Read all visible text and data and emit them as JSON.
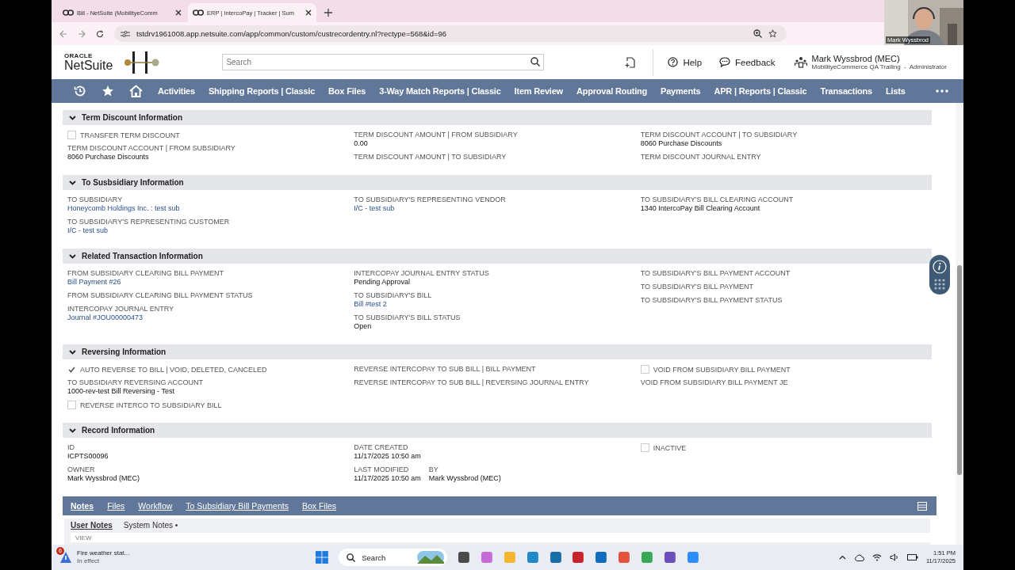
{
  "browser": {
    "tabs": [
      {
        "title": "Bill - NetSuite (MobilityeComm",
        "selected": false
      },
      {
        "title": "ERP | IntercoPay | Tracker | Sum",
        "selected": true
      }
    ],
    "url": "tstdrv1961008.app.netsuite.com/app/common/custom/custrecordentry.nl?rectype=568&id=96"
  },
  "webcam": {
    "name": "Mark Wyssbrod"
  },
  "header": {
    "logo_top": "ORACLE",
    "logo_bottom": "NetSuite",
    "search_placeholder": "Search",
    "help": "Help",
    "feedback": "Feedback",
    "user": "Mark Wyssbrod (MEC)",
    "account": "MobilityeCommerce QA Trailing  -  Administrator"
  },
  "nav": [
    "Activities",
    "Shipping Reports | Classic",
    "Box Files",
    "3-Way Match Reports | Classic",
    "Item Review",
    "Approval Routing",
    "Payments",
    "APR | Reports | Classic",
    "Transactions",
    "Lists"
  ],
  "sections": [
    {
      "title": "Term Discount Information",
      "expanded": true,
      "columns": [
        [
          {
            "kind": "checkbox",
            "label": "TRANSFER TERM DISCOUNT",
            "checked": false
          },
          {
            "kind": "field",
            "label": "TERM DISCOUNT ACCOUNT | FROM SUBSIDIARY",
            "value": "8060 Purchase Discounts",
            "link": false
          }
        ],
        [
          {
            "kind": "field",
            "label": "TERM DISCOUNT AMOUNT | FROM SUBSIDIARY",
            "value": "0.00",
            "link": false
          },
          {
            "kind": "field",
            "label": "TERM DISCOUNT AMOUNT | TO SUBSIDIARY"
          }
        ],
        [
          {
            "kind": "field",
            "label": "TERM DISCOUNT ACCOUNT | TO SUBSIDIARY",
            "value": "8060 Purchase Discounts",
            "link": false
          },
          {
            "kind": "field",
            "label": "TERM DISCOUNT JOURNAL ENTRY"
          }
        ]
      ]
    },
    {
      "title": "To Susbsidiary Information",
      "expanded": true,
      "columns": [
        [
          {
            "kind": "field",
            "label": "TO SUBSIDIARY",
            "value": "Honeycomb Holdings Inc. : test sub",
            "link": true
          },
          {
            "kind": "field",
            "label": "TO SUBSIDIARY'S REPRESENTING CUSTOMER",
            "value": "I/C - test sub",
            "link": true
          }
        ],
        [
          {
            "kind": "field",
            "label": "TO SUBSIDIARY'S REPRESENTING VENDOR",
            "value": "I/C - test sub",
            "link": true
          }
        ],
        [
          {
            "kind": "field",
            "label": "TO SUBSIDIARY'S BILL CLEARING ACCOUNT",
            "value": "1340 IntercoPay Bill Clearing Account",
            "link": false
          }
        ]
      ]
    },
    {
      "title": "Related Transaction Information",
      "expanded": true,
      "columns": [
        [
          {
            "kind": "field",
            "label": "FROM SUBSIDIARY CLEARING BILL PAYMENT",
            "value": "Bill Payment #26",
            "link": true
          },
          {
            "kind": "field",
            "label": "FROM SUBSIDIARY CLEARING BILL PAYMENT STATUS"
          },
          {
            "kind": "field",
            "label": "INTERCOPAY JOURNAL ENTRY",
            "value": "Journal #JOU00000473",
            "link": true
          }
        ],
        [
          {
            "kind": "field",
            "label": "INTERCOPAY JOURNAL ENTRY STATUS",
            "value": "Pending Approval",
            "link": false
          },
          {
            "kind": "field",
            "label": "TO SUBSIDIARY'S BILL",
            "value": "Bill #test 2",
            "link": true
          },
          {
            "kind": "field",
            "label": "TO SUBSIDIARY'S BILL STATUS",
            "value": "Open",
            "link": false
          }
        ],
        [
          {
            "kind": "field",
            "label": "TO SUBSIDIARY'S BILL PAYMENT ACCOUNT"
          },
          {
            "kind": "field",
            "label": "TO SUBSIDIARY'S BILL PAYMENT"
          },
          {
            "kind": "field",
            "label": "TO SUBSIDIARY'S BILL PAYMENT STATUS"
          }
        ]
      ]
    },
    {
      "title": "Reversing Information",
      "expanded": true,
      "columns": [
        [
          {
            "kind": "checkbox",
            "label": "AUTO REVERSE TO BILL | VOID, DELETED, CANCELED",
            "checked": true
          },
          {
            "kind": "field",
            "label": "TO SUBSIDIARY REVERSING ACCOUNT",
            "value": "1000-rev-test Bill Reversing - Test",
            "link": false
          },
          {
            "kind": "checkbox",
            "label": "REVERSE INTERCO TO SUBSIDIARY BILL",
            "checked": false
          }
        ],
        [
          {
            "kind": "field",
            "label": "REVERSE INTERCOPAY TO SUB BILL | BILL PAYMENT"
          },
          {
            "kind": "field",
            "label": "REVERSE INTERCOPAY TO SUB BILL | REVERSING JOURNAL ENTRY"
          }
        ],
        [
          {
            "kind": "checkbox",
            "label": "VOID FROM SUBSIDIARY BILL PAYMENT",
            "checked": false
          },
          {
            "kind": "field",
            "label": "VOID FROM SUBSIDIARY BILL PAYMENT JE"
          }
        ]
      ]
    },
    {
      "title": "Record Information",
      "expanded": true,
      "columns": [
        [
          {
            "kind": "field",
            "label": "ID",
            "value": "ICPTS00096",
            "link": false
          },
          {
            "kind": "field",
            "label": "OWNER",
            "value": "Mark Wyssbrod (MEC)",
            "link": false
          }
        ],
        [
          {
            "kind": "field",
            "label": "DATE CREATED",
            "value": "11/17/2025 10:50 am",
            "link": false
          },
          {
            "kind": "pair",
            "items": [
              {
                "label": "LAST MODIFIED",
                "value": "11/17/2025 10:50 am"
              },
              {
                "label": "BY",
                "value": "Mark Wyssbrod (MEC)"
              }
            ]
          }
        ],
        [
          {
            "kind": "checkbox",
            "label": "INACTIVE",
            "checked": false
          }
        ]
      ]
    }
  ],
  "subtabs": [
    {
      "label": "Notes",
      "selected": true
    },
    {
      "label": "Files",
      "selected": false
    },
    {
      "label": "Workflow",
      "selected": false
    },
    {
      "label": "To Subsidiary Bill Payments",
      "selected": false
    },
    {
      "label": "Box Files",
      "selected": false
    }
  ],
  "inner_tabs": [
    {
      "label": "User Notes",
      "selected": true
    },
    {
      "label": "System Notes •",
      "selected": false
    }
  ],
  "list_header": "VIEW",
  "taskbar": {
    "weather_badge": "6",
    "weather_title": "Fire weather stat...",
    "weather_sub": "In effect",
    "search": "Search",
    "time": "1:51 PM",
    "date": "11/17/2025"
  }
}
